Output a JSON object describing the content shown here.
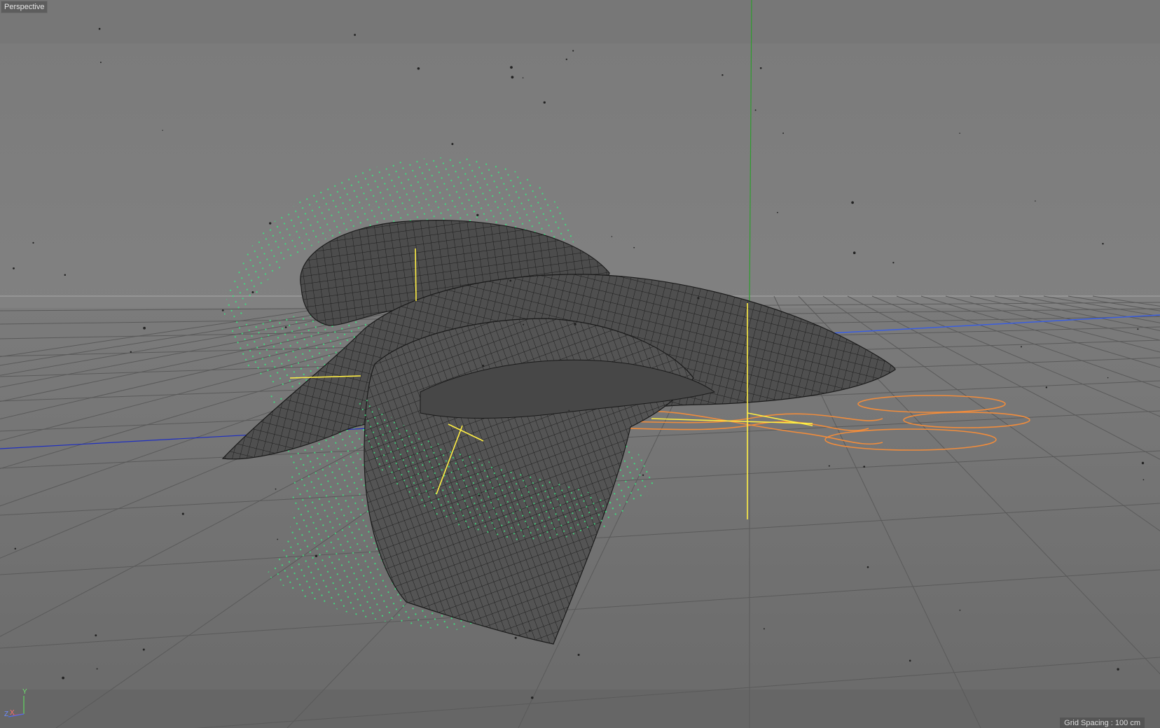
{
  "viewport": {
    "view_name": "Perspective",
    "grid_spacing_text": "Grid Spacing : 100 cm"
  },
  "axis_gizmo": {
    "y_label": "Y",
    "z_label": "Z",
    "x_label": "X"
  },
  "colors": {
    "background_upper": "#7d7d7d",
    "background_floor": "#6f6f6f",
    "grid_line": "#565656",
    "mesh_fill": "#4b4b4b",
    "mesh_wire": "#1e1e1e",
    "particles": "#3fdc7f",
    "spline": "#f08c3c",
    "null_object": "#ffee44",
    "axis_y": "#2e9c2e",
    "axis_x_world": "#3a5ee0",
    "axis_z_world": "#2030c0"
  }
}
